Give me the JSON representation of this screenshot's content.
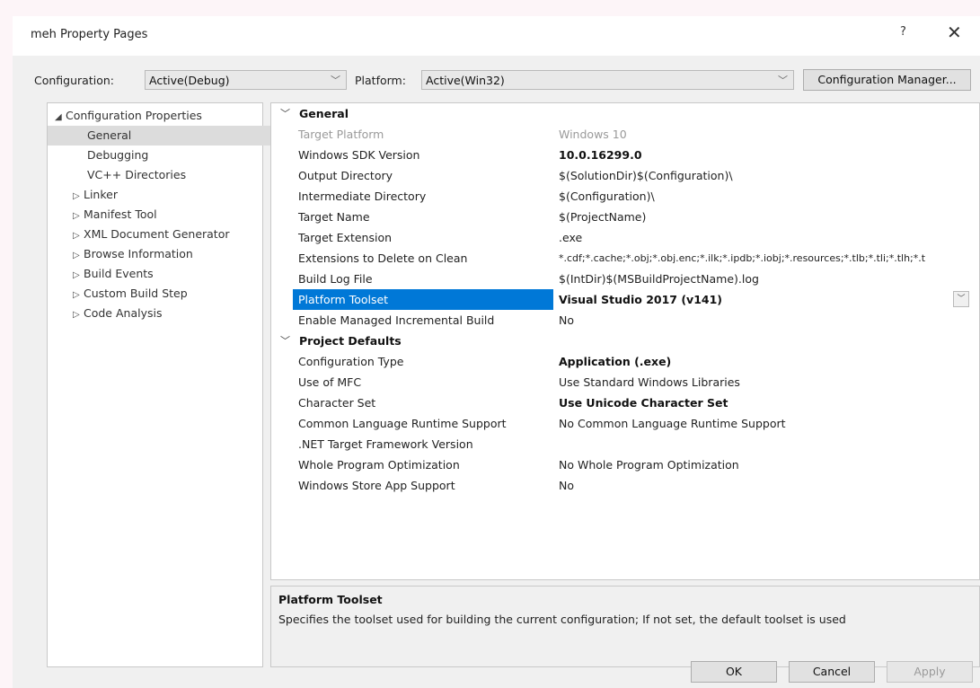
{
  "title": "meh Property Pages",
  "help_glyph": "?",
  "close_glyph": "✕",
  "configuration": {
    "label": "Configuration:",
    "value": "Active(Debug)"
  },
  "platform": {
    "label": "Platform:",
    "value": "Active(Win32)"
  },
  "config_manager_label": "Configuration Manager...",
  "tree": {
    "items": [
      {
        "label": "Configuration Properties",
        "twisty": "◢"
      },
      {
        "label": "General",
        "selected": true
      },
      {
        "label": "Debugging"
      },
      {
        "label": "VC++ Directories"
      },
      {
        "label": "Linker",
        "twisty": "▷"
      },
      {
        "label": "Manifest Tool",
        "twisty": "▷"
      },
      {
        "label": "XML Document Generator",
        "twisty": "▷"
      },
      {
        "label": "Browse Information",
        "twisty": "▷"
      },
      {
        "label": "Build Events",
        "twisty": "▷"
      },
      {
        "label": "Custom Build Step",
        "twisty": "▷"
      },
      {
        "label": "Code Analysis",
        "twisty": "▷"
      }
    ]
  },
  "categories": {
    "general": "General",
    "project_defaults": "Project Defaults"
  },
  "properties": [
    {
      "name": "Target Platform",
      "value": "Windows 10",
      "dim": true
    },
    {
      "name": "Windows SDK Version",
      "value": "10.0.16299.0",
      "bold": true
    },
    {
      "name": "Output Directory",
      "value": "$(SolutionDir)$(Configuration)\\"
    },
    {
      "name": "Intermediate Directory",
      "value": "$(Configuration)\\"
    },
    {
      "name": "Target Name",
      "value": "$(ProjectName)"
    },
    {
      "name": "Target Extension",
      "value": ".exe"
    },
    {
      "name": "Extensions to Delete on Clean",
      "value": "*.cdf;*.cache;*.obj;*.obj.enc;*.ilk;*.ipdb;*.iobj;*.resources;*.tlb;*.tli;*.tlh;*.t"
    },
    {
      "name": "Build Log File",
      "value": "$(IntDir)$(MSBuildProjectName).log"
    },
    {
      "name": "Platform Toolset",
      "value": "Visual Studio 2017 (v141)",
      "bold": true,
      "selected": true
    },
    {
      "name": "Enable Managed Incremental Build",
      "value": "No"
    }
  ],
  "defaults": [
    {
      "name": "Configuration Type",
      "value": "Application (.exe)",
      "bold": true
    },
    {
      "name": "Use of MFC",
      "value": "Use Standard Windows Libraries"
    },
    {
      "name": "Character Set",
      "value": "Use Unicode Character Set",
      "bold": true
    },
    {
      "name": "Common Language Runtime Support",
      "value": "No Common Language Runtime Support"
    },
    {
      "name": ".NET Target Framework Version",
      "value": ""
    },
    {
      "name": "Whole Program Optimization",
      "value": "No Whole Program Optimization"
    },
    {
      "name": "Windows Store App Support",
      "value": "No"
    }
  ],
  "description": {
    "title": "Platform Toolset",
    "text": "Specifies the toolset used for building the current configuration; If not set, the default toolset is used"
  },
  "buttons": {
    "ok": "OK",
    "cancel": "Cancel",
    "apply": "Apply"
  },
  "colors": {
    "selection": "#0078d7",
    "dialog_bg": "#f0f0f0",
    "disabled_text": "#9a9a9a"
  }
}
